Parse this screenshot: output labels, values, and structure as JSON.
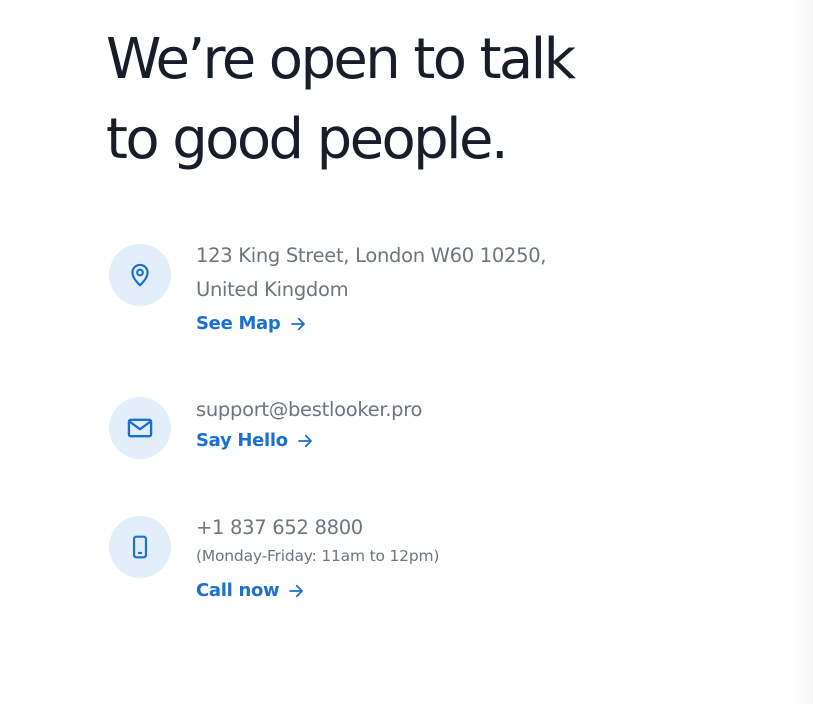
{
  "headline": {
    "line1": "We’re open to talk",
    "line2": "to good people."
  },
  "contacts": {
    "address": {
      "icon": "map-pin-icon",
      "line1": "123 King Street, London W60 10250,",
      "line2": "United Kingdom",
      "link_label": "See Map"
    },
    "email": {
      "icon": "mail-icon",
      "value": "support@bestlooker.pro",
      "link_label": "Say Hello"
    },
    "phone": {
      "icon": "mobile-phone-icon",
      "value": "+1 837 652 8800",
      "hours": "(Monday-Friday: 11am to 12pm)",
      "link_label": "Call now"
    }
  },
  "colors": {
    "heading": "#191d2a",
    "body_text": "#6f7480",
    "accent": "#1b6fd0",
    "icon_background": "#e3eefb"
  }
}
